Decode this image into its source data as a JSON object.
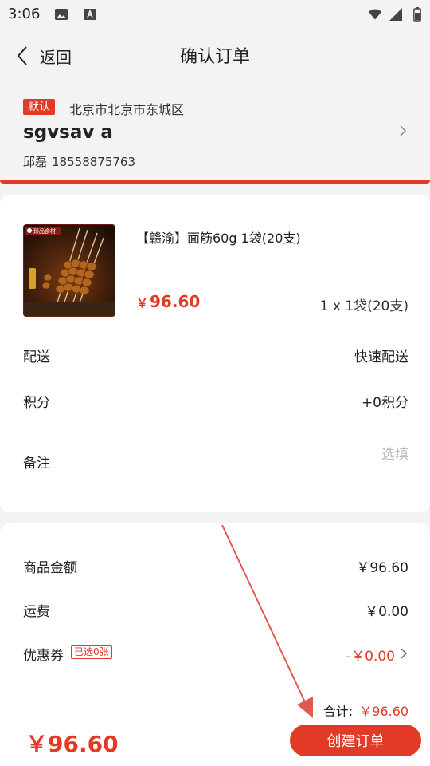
{
  "status_bar": {
    "time": "3:06"
  },
  "nav": {
    "back_label": "返回",
    "title": "确认订单"
  },
  "address": {
    "default_tag": "默认",
    "region": "北京市北京市东城区",
    "name": "sgvsav a",
    "contact_name": "邱磊",
    "phone": "18558875763"
  },
  "product": {
    "name": "【赣渝】面筋60g 1袋(20支)",
    "price_symbol": "￥",
    "price": "96.60",
    "quantity": "1 x 1袋(20支)",
    "thumb_logo_text": "臻品食材"
  },
  "options": {
    "delivery_label": "配送",
    "delivery_value": "快速配送",
    "points_label": "积分",
    "points_value": "+0积分",
    "note_label": "备注",
    "note_placeholder": "选填"
  },
  "summary": {
    "goods_amount_label": "商品金额",
    "goods_amount_value": "￥96.60",
    "shipping_label": "运费",
    "shipping_value": "￥0.00",
    "coupon_label": "优惠券",
    "coupon_badge": "已选0张",
    "coupon_value": "-￥0.00",
    "total_label": "合计:",
    "total_value": "￥96.60"
  },
  "footer": {
    "price": "￥96.60",
    "create_button": "创建订单"
  },
  "colors": {
    "accent": "#e23a26",
    "background": "#f3f3f3",
    "card": "#ffffff"
  }
}
